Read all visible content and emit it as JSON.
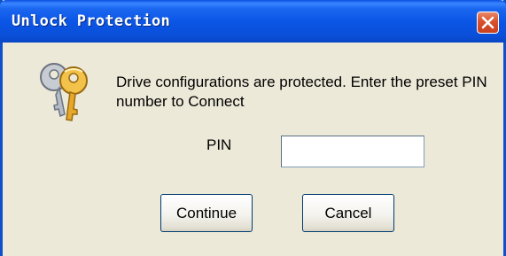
{
  "window": {
    "title": "Unlock Protection",
    "close_icon": "close-icon"
  },
  "dialog": {
    "icon": "keys-icon",
    "message": "Drive configurations are protected. Enter the preset PIN number to Connect",
    "pin_label": "PIN",
    "pin_value": "",
    "continue_label": "Continue",
    "cancel_label": "Cancel"
  },
  "colors": {
    "titlebar": "#0b56e6",
    "dialog_bg": "#ece9d8",
    "close_button": "#d9502c"
  }
}
